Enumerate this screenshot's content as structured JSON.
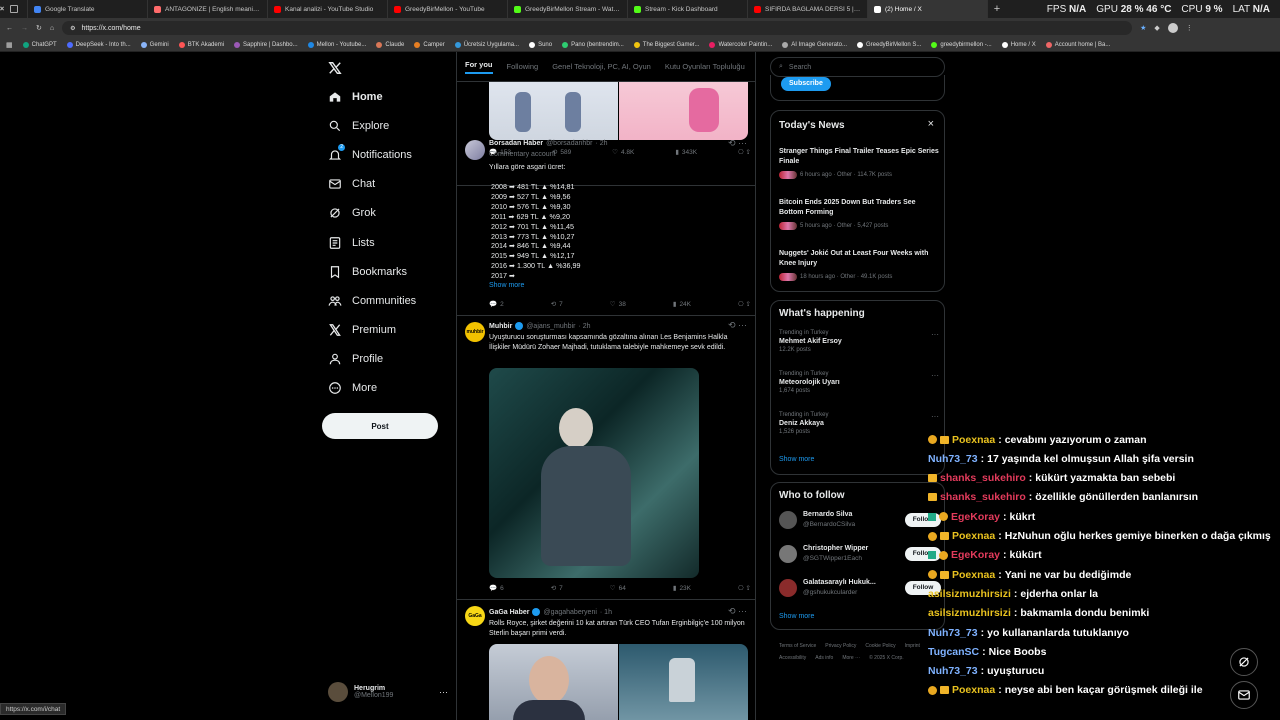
{
  "browser": {
    "tabs": [
      {
        "title": "Google Translate",
        "color": "#4285f4"
      },
      {
        "title": "ANTAGONIZE | English meaning ...",
        "color": "#ff6b6b"
      },
      {
        "title": "Kanal analizi - YouTube Studio",
        "color": "#ff0000"
      },
      {
        "title": "GreedyBirMellon - YouTube",
        "color": "#ff0000"
      },
      {
        "title": "GreedyBirMellon Stream - Watch ...",
        "color": "#53fc18"
      },
      {
        "title": "Stream - Kick Dashboard",
        "color": "#53fc18"
      },
      {
        "title": "SIFIRDA BAĞLAMA DERSİ 5 | Nota...",
        "color": "#ff0000"
      },
      {
        "title": "(2) Home / X",
        "color": "#ffffff"
      }
    ],
    "new_tab": "+",
    "stats": {
      "fps_label": "FPS",
      "fps": "N/A",
      "gpu_label": "GPU",
      "gpu_load": "28 %",
      "gpu_temp": "46 °C",
      "cpu_label": "CPU",
      "cpu": "9 %",
      "lat_label": "LAT",
      "lat": "N/A"
    },
    "url": "https://x.com/home",
    "bookmarks": [
      "ChatGPT",
      "DeepSeek - Into th...",
      "Gemini",
      "BTK Akademi",
      "Sapphire | Dashbo...",
      "Mellon - Youtube...",
      "Claude",
      "Camper",
      "Ücretsiz Uygulama...",
      "Suno",
      "Pano (bentrendim...",
      "The Biggest Gamer...",
      "Watercolor Paintin...",
      "AI Image Generato...",
      "GreedyBirMellon S...",
      "greedybirmellon -...",
      "Home / X",
      "Account home | Ba..."
    ],
    "status_url": "https://x.com/i/chat"
  },
  "nav": {
    "items": [
      {
        "label": "Home",
        "icon": "home-icon"
      },
      {
        "label": "Explore",
        "icon": "search-icon"
      },
      {
        "label": "Notifications",
        "icon": "bell-icon"
      },
      {
        "label": "Chat",
        "icon": "mail-icon"
      },
      {
        "label": "Grok",
        "icon": "grok-icon"
      },
      {
        "label": "Lists",
        "icon": "list-icon"
      },
      {
        "label": "Bookmarks",
        "icon": "bookmark-icon"
      },
      {
        "label": "Communities",
        "icon": "people-icon"
      },
      {
        "label": "Premium",
        "icon": "x-logo-icon"
      },
      {
        "label": "Profile",
        "icon": "user-icon"
      },
      {
        "label": "More",
        "icon": "more-icon"
      }
    ],
    "notif_count": "2",
    "post_label": "Post",
    "account": {
      "name": "Herugrim",
      "handle": "@Mellon199",
      "more": "···"
    }
  },
  "feed": {
    "tabs": [
      "For you",
      "Following",
      "Genel Teknoloji, PC, AI, Oyun",
      "Kutu Oyunları Topluluğu"
    ],
    "top_actions": {
      "replies": "153",
      "reposts": "589",
      "likes": "4.8K",
      "views": "343K"
    },
    "posts": [
      {
        "name": "Borsadan Haber",
        "handle": "@borsadanhbr",
        "time": "· 2h",
        "sub": "Commentary account",
        "intro": "Yıllara göre asgari ücret:",
        "lines": [
          "2008 ➡ 481 TL ▲ %14,81",
          "2009 ➡ 527 TL ▲ %9,56",
          "2010 ➡ 576 TL ▲ %9,30",
          "2011 ➡ 629 TL ▲ %9,20",
          "2012 ➡ 701 TL ▲ %11,45",
          "2013 ➡ 773 TL ▲ %10,27",
          "2014 ➡ 846 TL ▲ %9,44",
          "2015 ➡ 949 TL ▲ %12,17",
          "2016 ➡ 1.300 TL ▲ %36,99",
          "2017 ➡"
        ],
        "show_more": "Show more",
        "replies": "2",
        "reposts": "7",
        "likes": "38",
        "views": "24K"
      },
      {
        "name": "Muhbir",
        "handle": "@ajans_muhbir",
        "time": "· 2h",
        "text": "Uyuşturucu soruşturması kapsamında gözaltına alınan Les Benjamins Halkla İlişkiler Müdürü Zohaer Majhadi, tutuklama talebiyle mahkemeye sevk edildi.",
        "avatar_text": "muhbir",
        "replies": "6",
        "reposts": "7",
        "likes": "64",
        "views": "23K"
      },
      {
        "name": "GaGa Haber",
        "handle": "@gagahaberyeni",
        "time": "· 1h",
        "text": "Rolls Royce, şirket değerini 10 kat artıran Türk CEO Tufan Erginbilgiç'e 100 milyon Sterlin başarı primi verdi.",
        "avatar_text": "GaGa"
      }
    ]
  },
  "right": {
    "search_placeholder": "Search",
    "subscribe_label": "Subscribe",
    "news": {
      "title": "Today's News",
      "close": "×",
      "items": [
        {
          "title": "Stranger Things Final Trailer Teases Epic Series Finale",
          "meta": "6 hours ago · Other · 114.7K posts"
        },
        {
          "title": "Bitcoin Ends 2025 Down But Traders See Bottom Forming",
          "meta": "5 hours ago · Other · 5,427 posts"
        },
        {
          "title": "Nuggets' Jokić Out at Least Four Weeks with Knee Injury",
          "meta": "18 hours ago · Other · 49.1K posts"
        }
      ]
    },
    "happening": {
      "title": "What's happening",
      "items": [
        {
          "ctx": "Trending in Turkey",
          "name": "Mehmet Akif Ersoy",
          "posts": "12.2K posts"
        },
        {
          "ctx": "Trending in Turkey",
          "name": "Meteorolojik Uyarı",
          "posts": "1,674 posts"
        },
        {
          "ctx": "Trending in Turkey",
          "name": "Deniz Akkaya",
          "posts": "1,526 posts"
        }
      ],
      "show_more": "Show more"
    },
    "who_to_follow": {
      "title": "Who to follow",
      "items": [
        {
          "name": "Bernardo Silva",
          "handle": "@BernardoCSilva"
        },
        {
          "name": "Christopher Wipper",
          "handle": "@SGTWipper1Each"
        },
        {
          "name": "Galatasaraylı Hukuk...",
          "handle": "@gshukukcularder"
        }
      ],
      "follow_label": "Follow",
      "show_more": "Show more"
    },
    "footer": [
      "Terms of Service",
      "Privacy Policy",
      "Cookie Policy",
      "Imprint",
      "Accessibility",
      "Ads info",
      "More ···",
      "© 2025 X Corp."
    ]
  },
  "chat": {
    "messages": [
      {
        "user": "Poexnaa",
        "color": "#e9c21f",
        "text": "cevabını yazıyorum o zaman",
        "badges": [
          "b1",
          "b2"
        ]
      },
      {
        "user": "Nuh73_73",
        "color": "#7fb2ff",
        "text": "17 yaşında kel olmuşsun Allah şifa versin",
        "badges": []
      },
      {
        "user": "shanks_sukehiro",
        "color": "#e33b5c",
        "text": "kükürt yazmakta ban sebebi",
        "badges": [
          "b2"
        ]
      },
      {
        "user": "shanks_sukehiro",
        "color": "#e33b5c",
        "text": "özellikle gönüllerden banlanırsın",
        "badges": [
          "b2"
        ]
      },
      {
        "user": "EgeKoray",
        "color": "#e33b5c",
        "text": "kükrt",
        "badges": [
          "b3",
          "b1"
        ]
      },
      {
        "user": "Poexnaa",
        "color": "#e9c21f",
        "text": "HzNuhun oğlu herkes gemiye binerken o dağa çıkmış",
        "badges": [
          "b1",
          "b2"
        ]
      },
      {
        "user": "EgeKoray",
        "color": "#e33b5c",
        "text": "kükürt",
        "badges": [
          "b3",
          "b1"
        ]
      },
      {
        "user": "Poexnaa",
        "color": "#e9c21f",
        "text": "Yani ne var bu dediğimde",
        "badges": [
          "b1",
          "b2"
        ]
      },
      {
        "user": "asilsizmuzhirsizi",
        "color": "#e9c21f",
        "text": "ejderha onlar la",
        "badges": []
      },
      {
        "user": "asilsizmuzhirsizi",
        "color": "#e9c21f",
        "text": "bakmamla dondu benimki",
        "badges": []
      },
      {
        "user": "Nuh73_73",
        "color": "#7fb2ff",
        "text": "yo kullananlarda tutuklanıyo",
        "badges": []
      },
      {
        "user": "TugcanSC",
        "color": "#7fb2ff",
        "text": "Nice Boobs",
        "badges": []
      },
      {
        "user": "Nuh73_73",
        "color": "#7fb2ff",
        "text": "uyuşturucu",
        "badges": []
      },
      {
        "user": "Poexnaa",
        "color": "#e9c21f",
        "text": "neyse abi ben kaçar görüşmek dileği ile",
        "badges": [
          "b1",
          "b2"
        ]
      }
    ]
  },
  "colors": {
    "accent": "#1d9bf0",
    "bg": "#000000",
    "border": "#2f3336",
    "muted": "#71767b"
  }
}
